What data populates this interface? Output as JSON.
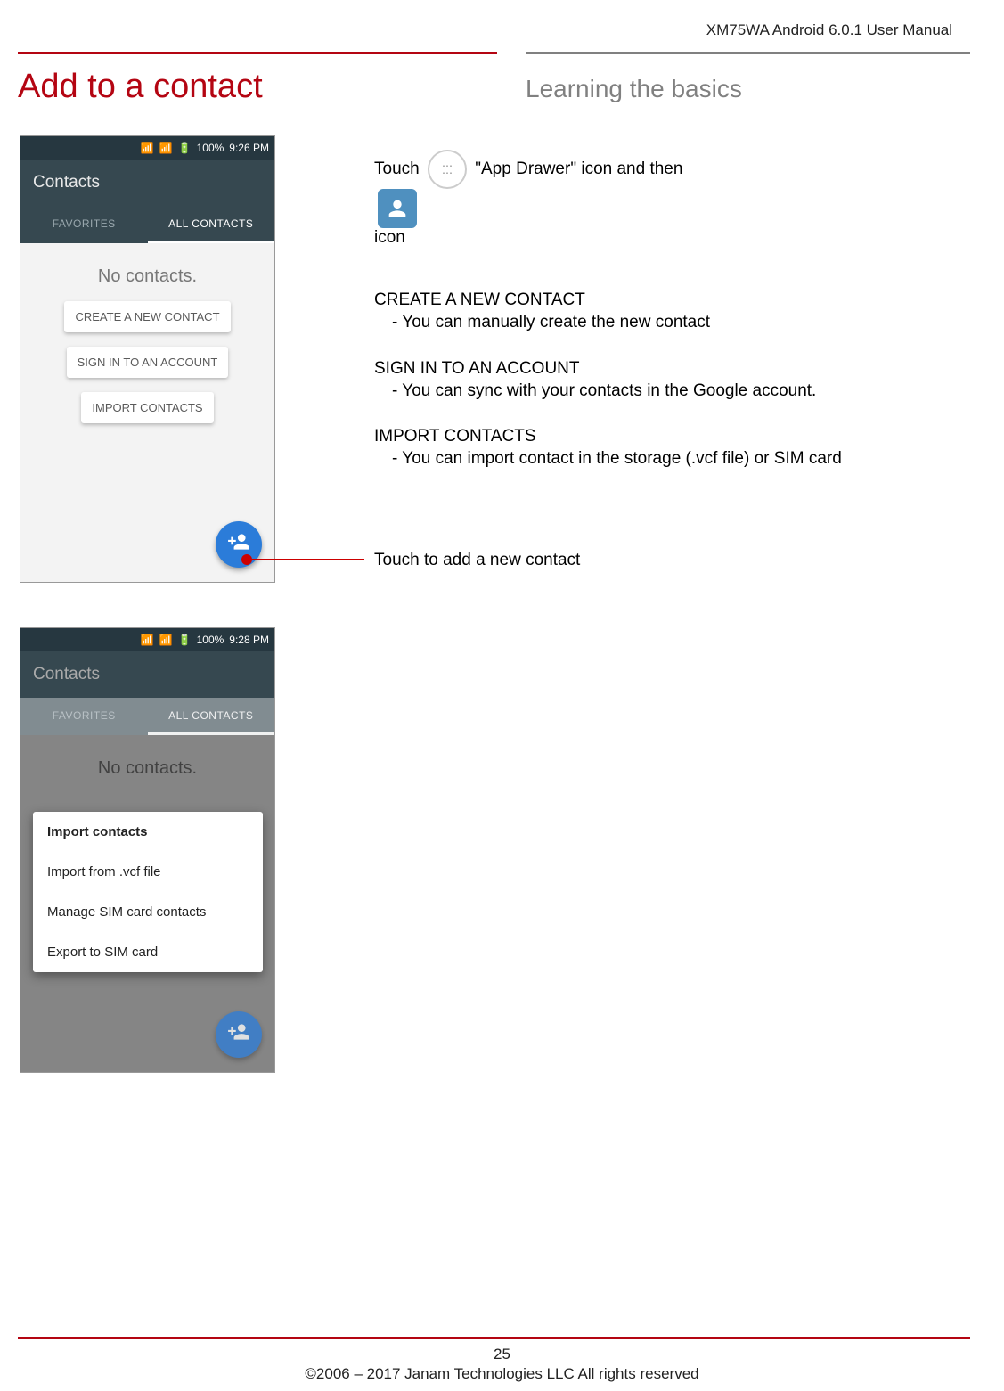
{
  "doc_header": "XM75WA Android 6.0.1 User Manual",
  "title": "Add to a contact",
  "subtitle": "Learning the basics",
  "intro": {
    "p1_a": "Touch",
    "p1_b": "\"App Drawer\" icon and then",
    "p1_c": "icon"
  },
  "sections": {
    "s1_h": "CREATE A NEW CONTACT",
    "s1_b": "You can manually create the new contact",
    "s2_h": "SIGN IN TO AN ACCOUNT",
    "s2_b": "You can sync with your contacts in the Google account.",
    "s3_h": "IMPORT CONTACTS",
    "s3_b": "You can import contact in the storage (.vcf file) or SIM card"
  },
  "callout": "Touch to add a new contact",
  "phone1": {
    "time": "9:26 PM",
    "battery": "100%",
    "app_title": "Contacts",
    "tab1": "FAVORITES",
    "tab2": "ALL CONTACTS",
    "empty": "No contacts.",
    "btn1": "CREATE A NEW CONTACT",
    "btn2": "SIGN IN TO AN ACCOUNT",
    "btn3": "IMPORT CONTACTS"
  },
  "phone2": {
    "time": "9:28 PM",
    "battery": "100%",
    "app_title": "Contacts",
    "tab1": "FAVORITES",
    "tab2": "ALL CONTACTS",
    "empty": "No contacts.",
    "menu": {
      "m1": "Import contacts",
      "m2": "Import from .vcf file",
      "m3": "Manage SIM card contacts",
      "m4": "Export to SIM card"
    }
  },
  "footer": {
    "page": "25",
    "copyright": "©2006 – 2017 Janam Technologies LLC All rights reserved"
  }
}
